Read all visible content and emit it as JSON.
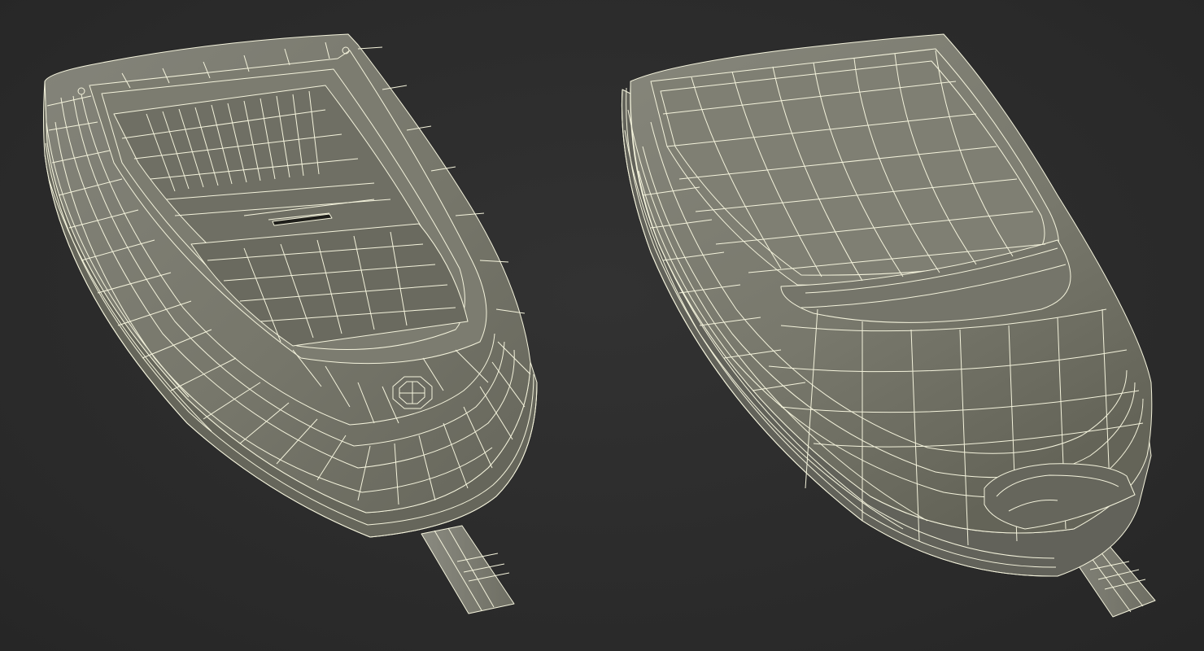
{
  "scene": {
    "background_color": "#2b2b2b",
    "surface_color": "#79796b",
    "surface_shadow_color": "#5d5d52",
    "wire_color": "#f4f3dc",
    "views": [
      {
        "name": "glucose-meter-front-view"
      },
      {
        "name": "glucose-meter-back-view"
      }
    ]
  }
}
